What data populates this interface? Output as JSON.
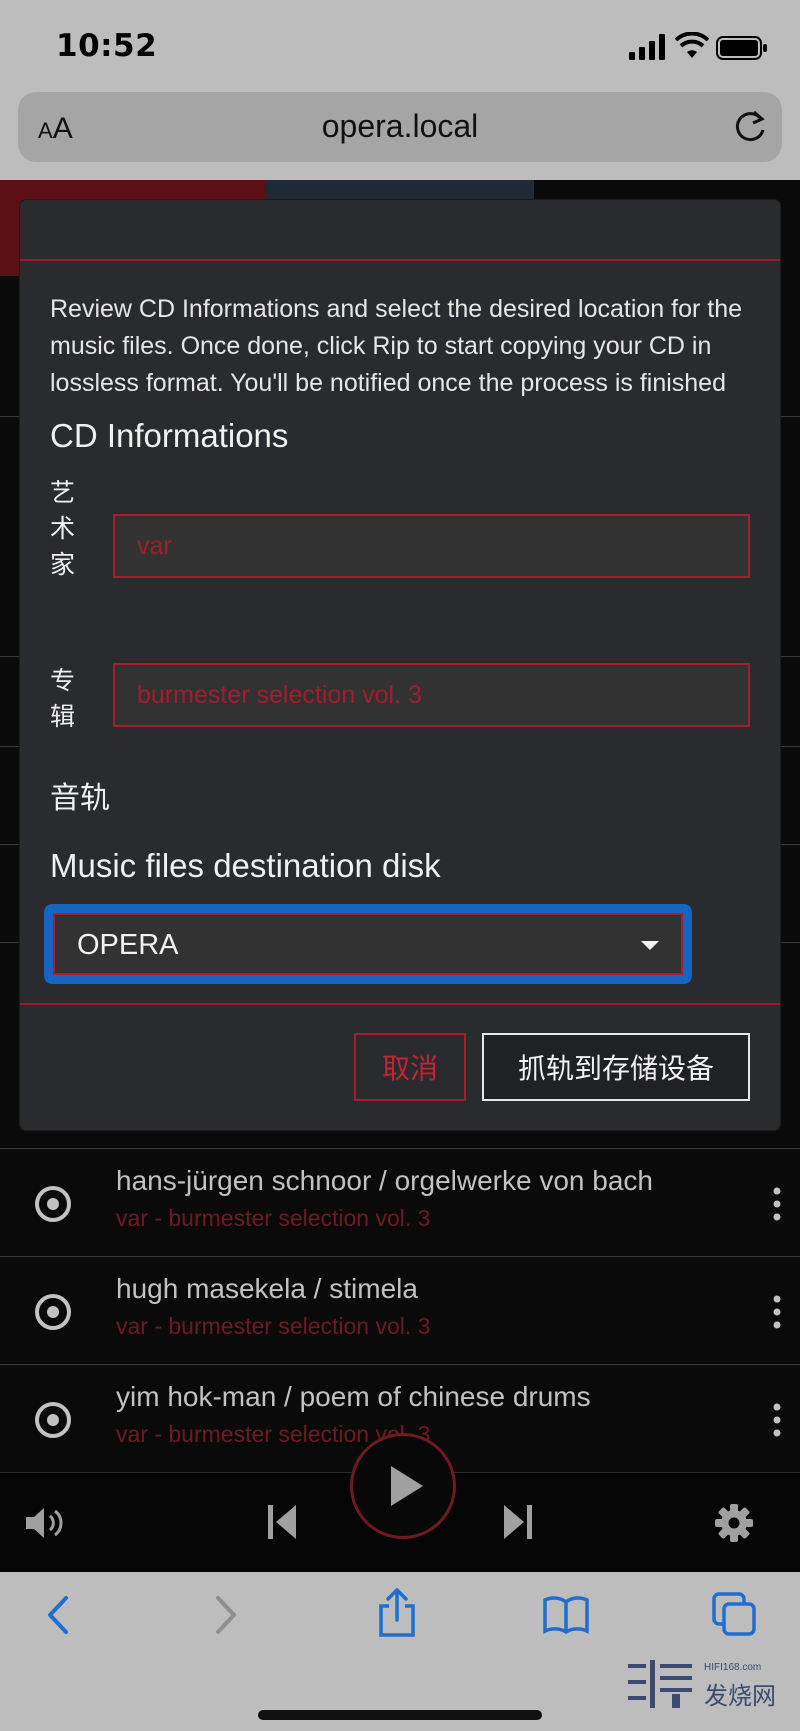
{
  "status_bar": {
    "time": "10:52"
  },
  "safari": {
    "aa_small": "A",
    "aa_large": "A",
    "url": "opera.local"
  },
  "modal": {
    "description": "Review CD Informations and select the desired location for the music files. Once done, click Rip to start copying your CD in lossless format. You'll be notified once the process is finished",
    "cd_section_title": "CD Informations",
    "artist_label": "艺术家",
    "artist_value": "var",
    "album_label": "专辑",
    "album_value": "burmester selection vol. 3",
    "tracks_label": "音轨",
    "destination_title": "Music files destination disk",
    "destination_value": "OPERA",
    "cancel_label": "取消",
    "rip_label": "抓轨到存储设备"
  },
  "tracks": [
    {
      "title": "hans-jürgen schnoor / orgelwerke von bach",
      "subtitle": "var - burmester selection vol. 3"
    },
    {
      "title": "hugh masekela / stimela",
      "subtitle": "var - burmester selection vol. 3"
    },
    {
      "title": "yim hok-man / poem of chinese drums",
      "subtitle": "var - burmester selection vol. 3"
    }
  ],
  "watermark": {
    "site": "HIFI168.com",
    "text": "发烧网"
  },
  "colors": {
    "accent": "#a81c2d",
    "focus": "#1565c0",
    "background": "#0a0a0a",
    "modal": "#2a2b2f"
  }
}
